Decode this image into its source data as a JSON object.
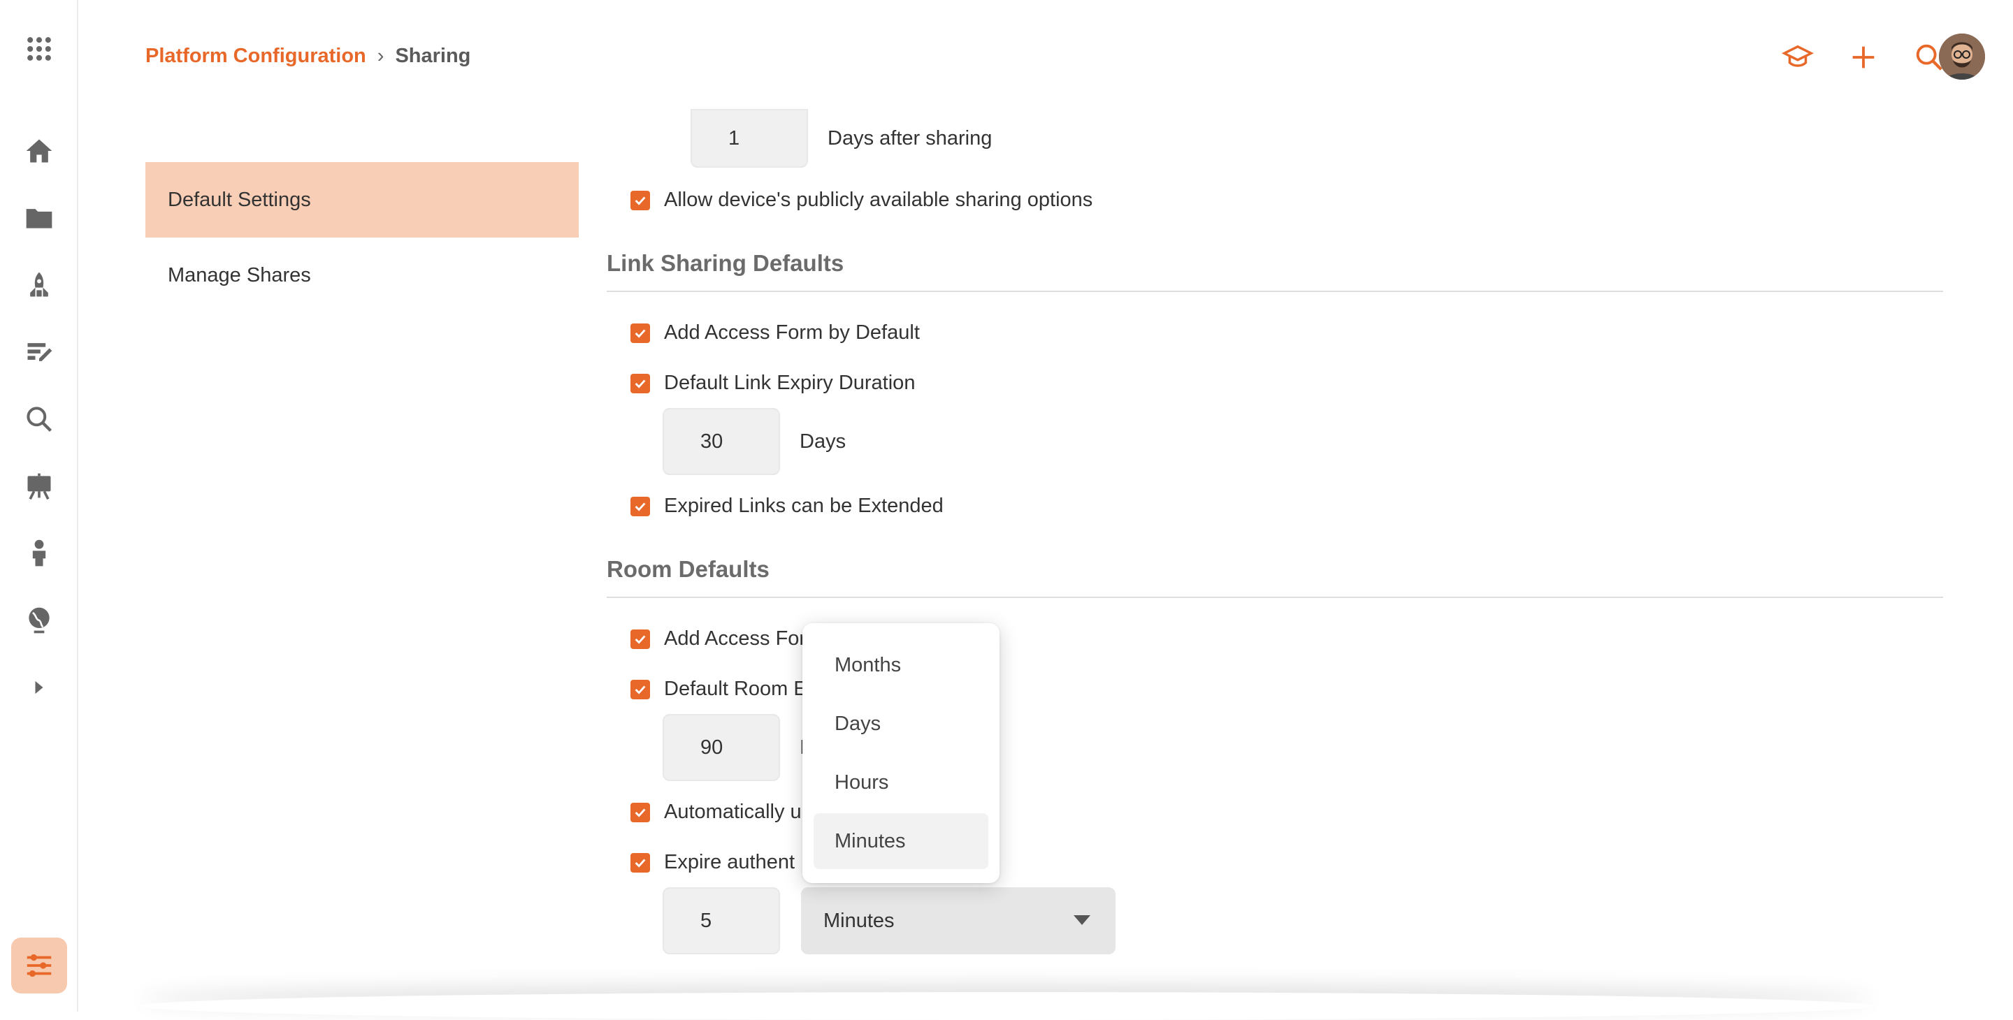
{
  "breadcrumb": {
    "parent": "Platform Configuration",
    "separator": "›",
    "current": "Sharing"
  },
  "rail": {
    "icons": [
      "apps-grid-icon",
      "home-icon",
      "folder-icon",
      "rocket-icon",
      "edit-note-icon",
      "search-icon",
      "presentation-icon",
      "person-icon",
      "globe-icon",
      "expand-arrow-icon",
      "settings-sliders-icon"
    ]
  },
  "top_actions": [
    "graduation-cap-icon",
    "plus-icon",
    "search-icon",
    "user-avatar"
  ],
  "side_nav": {
    "items": [
      {
        "label": "Default Settings",
        "selected": true
      },
      {
        "label": "Manage Shares",
        "selected": false
      }
    ]
  },
  "general": {
    "days_value": "1",
    "days_after_label": "Days after sharing",
    "allow_public_label": "Allow device's publicly available sharing options"
  },
  "link_sharing": {
    "title": "Link Sharing Defaults",
    "access_form_label": "Add Access Form by Default",
    "expiry_label": "Default Link Expiry Duration",
    "expiry_value": "30",
    "expiry_unit": "Days",
    "extend_label": "Expired Links can be Extended"
  },
  "room_defaults": {
    "title": "Room Defaults",
    "access_form_label": "Add Access For",
    "room_expiry_label": "Default Room E",
    "room_expiry_value": "90",
    "room_expiry_unit_partial": "I",
    "auto_label": "Automatically u",
    "expire_auth_label": "Expire authent",
    "expire_auth_value": "5",
    "expire_auth_unit": "Minutes"
  },
  "dropdown": {
    "options": [
      "Months",
      "Days",
      "Hours",
      "Minutes"
    ],
    "highlighted": "Minutes"
  },
  "colors": {
    "accent": "#e8682a",
    "selected_nav": "#f8cfb6"
  }
}
